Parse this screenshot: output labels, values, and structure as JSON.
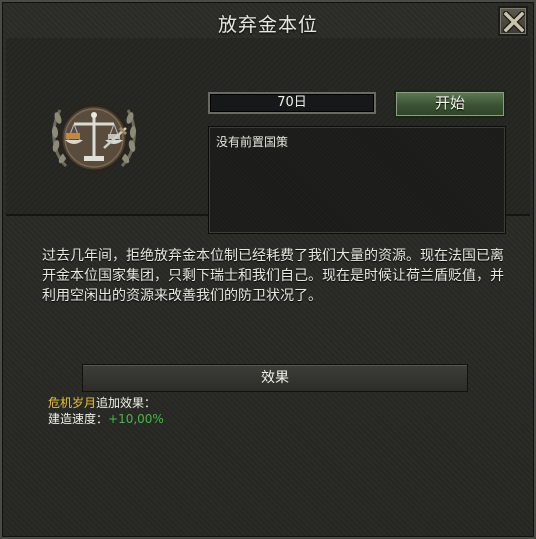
{
  "window": {
    "title": "放弃金本位"
  },
  "focus": {
    "days_label": "70日",
    "start_label": "开始",
    "prerequisites_text": "没有前置国策",
    "description": "过去几年间，拒绝放弃金本位制已经耗费了我们大量的资源。现在法国已离开金本位国家集团，只剩下瑞士和我们自己。现在是时候让荷兰盾贬值，并利用空闲出的资源来改善我们的防卫状况了。",
    "icon": "scales-of-justice-emblem-icon"
  },
  "effects": {
    "header": "效果",
    "modifier_name": "危机岁月",
    "modifier_suffix": "追加效果：",
    "line_label": "建造速度：",
    "line_value": "+10,00%"
  },
  "colors": {
    "highlight_gold": "#e8c23c",
    "positive_green": "#46b84a",
    "start_button": "#3b5233"
  }
}
